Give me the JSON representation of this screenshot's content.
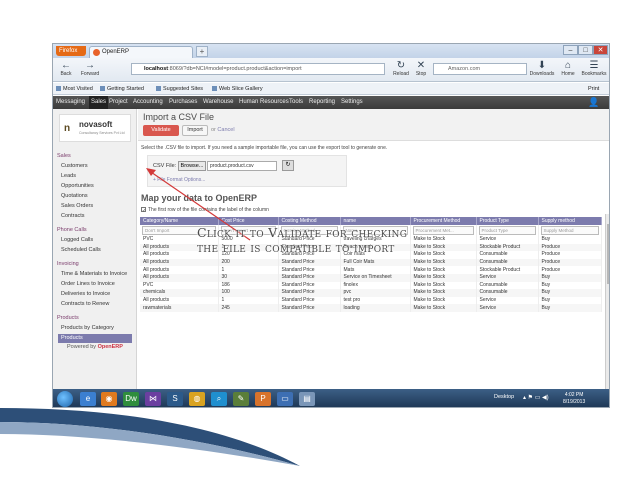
{
  "browser": {
    "menu_button": "Firefox",
    "tab_title": "OpenERP",
    "new_tab": "+",
    "window_controls": [
      "–",
      "□",
      "✕"
    ],
    "nav": {
      "back": "Back",
      "forward": "Forward",
      "reload": "Reload",
      "stop": "Stop",
      "downloads": "Downloads",
      "home": "Home",
      "bookmarks": "Bookmarks",
      "print": "Print"
    },
    "url_host": "localhost",
    "url_rest": ":8069/?db=NCI#model=product.product&action=import",
    "search_placeholder": "Amazon.com",
    "bookmarks_bar": [
      "Most Visited",
      "Getting Started",
      "Suggested Sites",
      "Web Slice Gallery"
    ]
  },
  "erp": {
    "top_menu": [
      "Messaging",
      "Sales",
      "Project",
      "Accounting",
      "Purchases",
      "Warehouse",
      "Human Resources",
      "Tools",
      "Reporting",
      "Settings"
    ],
    "active_menu": "Sales",
    "logo": {
      "mark": "n",
      "name": "novasoft",
      "tagline": "Consultancy Services Pvt Ltd"
    },
    "sidebar": {
      "sections": [
        {
          "title": "Sales",
          "items": [
            "Customers",
            "Leads",
            "Opportunities",
            "Quotations",
            "Sales Orders",
            "Contracts"
          ]
        },
        {
          "title": "Phone Calls",
          "items": [
            "Logged Calls",
            "Scheduled Calls"
          ]
        },
        {
          "title": "Invoicing",
          "items": [
            "Time & Materials to Invoice",
            "Order Lines to Invoice",
            "Deliveries to Invoice",
            "Contracts to Renew"
          ]
        },
        {
          "title": "Products",
          "items": [
            "Products by Category",
            "Products"
          ]
        }
      ],
      "selected_item": "Products",
      "powered_prefix": "Powered by",
      "powered_brand": "OpenERP"
    },
    "page_title": "Import a CSV File",
    "validate_label": "Validate",
    "import_label": "Import",
    "or_text": "or",
    "cancel_label": "Cancel",
    "help_text": "Select the .CSV file to import. If you need a sample importable file, you can use the export tool to generate one.",
    "file_label": "CSV File:",
    "browse_label": "Browse...",
    "file_value": "product.product.csv",
    "file_format_options": "+ File Format Options...",
    "map_title": "Map your data to OpenERP",
    "first_row_label": "The first row of the file contains the label of the column",
    "columns": [
      "Category/Name",
      "Cost Price",
      "Costing Method",
      "name",
      "Procurement Method",
      "Product Type",
      "Supply method"
    ],
    "selectors": [
      "Don't Import",
      "Don't Import",
      "Costing Method",
      "Name",
      "Procurement Met...",
      "Product Type",
      "Supply Method"
    ],
    "rows": [
      [
        "PVC",
        "5000",
        "Standard Price",
        "traveling charges",
        "Make to Stock",
        "Service",
        "Buy"
      ],
      [
        "All products",
        "1",
        "Standard Price",
        "Beach crawl",
        "Make to Stock",
        "Stockable Product",
        "Produce"
      ],
      [
        "All products",
        "120",
        "Standard Price",
        "Coir mats",
        "Make to Stock",
        "Consumable",
        "Produce"
      ],
      [
        "All products",
        "200",
        "Standard Price",
        "Full Coir Mats",
        "Make to Stock",
        "Consumable",
        "Produce"
      ],
      [
        "All products",
        "1",
        "Standard Price",
        "Mats",
        "Make to Stock",
        "Stockable Product",
        "Produce"
      ],
      [
        "All products",
        "30",
        "Standard Price",
        "Service on Timesheet",
        "Make to Stock",
        "Service",
        "Buy"
      ],
      [
        "PVC",
        "186",
        "Standard Price",
        "finolex",
        "Make to Stock",
        "Consumable",
        "Buy"
      ],
      [
        "chemicals",
        "100",
        "Standard Price",
        "pvc",
        "Make to Stock",
        "Consumable",
        "Buy"
      ],
      [
        "All products",
        "1",
        "Standard Price",
        "test pro",
        "Make to Stock",
        "Service",
        "Buy"
      ],
      [
        "rawmaterials",
        "245",
        "Standard Price",
        "loading",
        "Make to Stock",
        "Service",
        "Buy"
      ]
    ]
  },
  "annotation": {
    "line1": "Click it to Validate for checking",
    "line2": "the file is compatible to import"
  },
  "taskbar": {
    "desktop_label": "Desktop",
    "time": "4:02 PM",
    "date": "8/19/2013"
  },
  "colors": {
    "accent": "#7c7bad",
    "validate": "#d9574e",
    "arrow": "#d33a3a"
  }
}
